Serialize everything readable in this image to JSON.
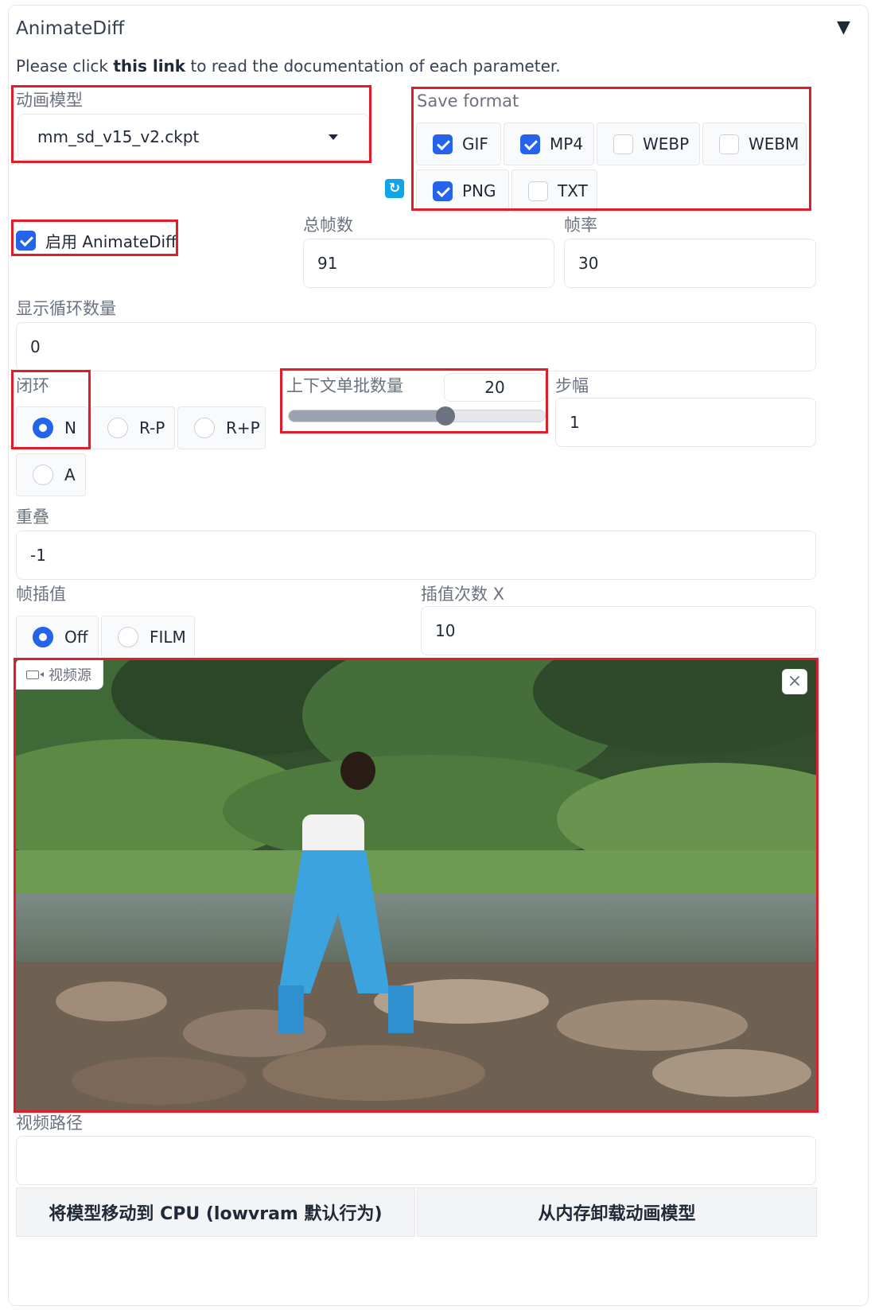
{
  "header": {
    "title": "AnimateDiff",
    "collapse_glyph": "▼",
    "doc_prefix": "Please click ",
    "doc_link": "this link",
    "doc_suffix": " to read the documentation of each parameter."
  },
  "motion_model": {
    "label": "动画模型",
    "value": "mm_sd_v15_v2.ckpt"
  },
  "refresh_icon": "refresh-icon",
  "save_format": {
    "label": "Save format",
    "options": [
      {
        "label": "GIF",
        "checked": true
      },
      {
        "label": "MP4",
        "checked": true
      },
      {
        "label": "WEBP",
        "checked": false
      },
      {
        "label": "WEBM",
        "checked": false
      },
      {
        "label": "PNG",
        "checked": true
      },
      {
        "label": "TXT",
        "checked": false
      }
    ]
  },
  "enable": {
    "label": "启用 AnimateDiff",
    "checked": true
  },
  "total_frames": {
    "label": "总帧数",
    "value": "91"
  },
  "fps": {
    "label": "帧率",
    "value": "30"
  },
  "loop_count": {
    "label": "显示循环数量",
    "value": "0"
  },
  "closed_loop": {
    "label": "闭环",
    "options": [
      {
        "label": "N",
        "selected": true
      },
      {
        "label": "R-P",
        "selected": false
      },
      {
        "label": "R+P",
        "selected": false
      },
      {
        "label": "A",
        "selected": false
      }
    ]
  },
  "context_batch": {
    "label": "上下文单批数量",
    "value": "20",
    "fraction": 0.61
  },
  "stride": {
    "label": "步幅",
    "value": "1"
  },
  "overlap": {
    "label": "重叠",
    "value": "-1"
  },
  "interp": {
    "label": "帧插值",
    "options": [
      {
        "label": "Off",
        "selected": true
      },
      {
        "label": "FILM",
        "selected": false
      }
    ]
  },
  "interp_x": {
    "label": "插值次数 X",
    "value": "10"
  },
  "video_source": {
    "label": "视频源",
    "close": "×"
  },
  "video_path": {
    "label": "视频路径",
    "value": ""
  },
  "buttons": {
    "move_to_cpu": "将模型移动到 CPU (lowvram 默认行为)",
    "unload": "从内存卸载动画模型"
  },
  "colors": {
    "accent": "#2563eb",
    "highlight": "#e11d2a"
  }
}
